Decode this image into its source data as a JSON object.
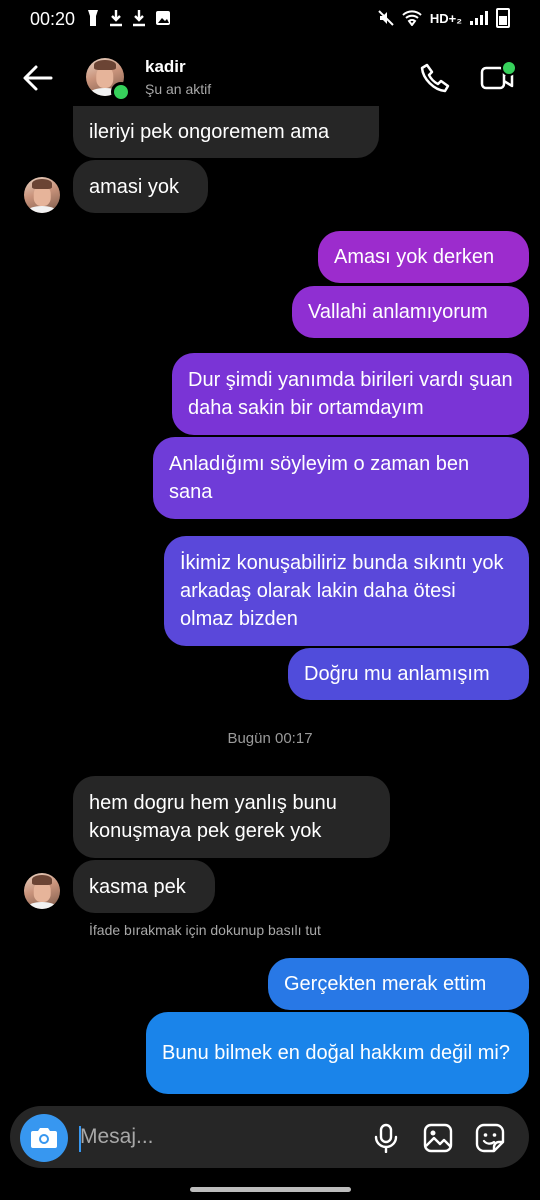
{
  "status_bar": {
    "time": "00:20",
    "left_icons": [
      "flashlight-icon",
      "download-icon",
      "download-icon",
      "gallery-icon"
    ],
    "network_label": "HD+₂"
  },
  "header": {
    "back_icon": "arrow-left-icon",
    "contact_name": "kadir",
    "presence": "Şu an aktif",
    "call_icon": "phone-icon",
    "video_icon": "video-camera-icon"
  },
  "messages": [
    {
      "side": "in",
      "text": "ileriyi pek ongoremem ama"
    },
    {
      "side": "in",
      "text": "amasi yok"
    },
    {
      "side": "out",
      "text": "Aması yok derken"
    },
    {
      "side": "out",
      "text": "Vallahi anlamıyorum"
    },
    {
      "side": "out",
      "text": "Dur şimdi yanımda birileri vardı şuan daha sakin bir ortamdayım"
    },
    {
      "side": "out",
      "text": "Anladığımı söyleyim o zaman ben sana"
    },
    {
      "side": "out",
      "text": "İkimiz konuşabiliriz bunda sıkıntı yok arkadaş olarak lakin daha ötesi olmaz bizden"
    },
    {
      "side": "out",
      "text": "Doğru mu anlamışım"
    },
    {
      "side": "in",
      "text": "hem dogru hem yanlış bunu konuşmaya pek gerek yok"
    },
    {
      "side": "in",
      "text": "kasma pek"
    },
    {
      "side": "out",
      "text": "Gerçekten merak ettim"
    },
    {
      "side": "out",
      "text": "Bunu bilmek en doğal hakkım değil mi?"
    }
  ],
  "time_separator": "Bugün 00:17",
  "reaction_hint": "İfade bırakmak için dokunup basılı tut",
  "composer": {
    "placeholder": "Mesaj...",
    "camera_icon": "camera-icon",
    "mic_icon": "microphone-icon",
    "gallery_icon": "gallery-icon",
    "sticker_icon": "sticker-icon"
  },
  "colors": {
    "background": "#000000",
    "incoming_bubble": "#262626",
    "outgoing_purple": "#7b2fd6",
    "outgoing_blue": "#1a7fe8",
    "online": "#36d15b",
    "accent": "#3797f0"
  }
}
